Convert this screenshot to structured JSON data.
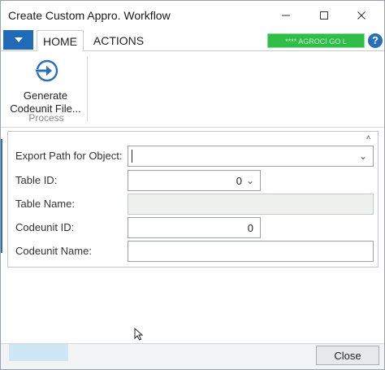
{
  "window": {
    "title": "Create Custom Appro. Workflow",
    "controls": {
      "minimize": "—",
      "maximize": "☐",
      "close": "✕"
    }
  },
  "tabs": [
    {
      "label": "HOME",
      "active": true
    },
    {
      "label": "ACTIONS",
      "active": false
    }
  ],
  "user_badge": "**** AGROCI GO L",
  "help_label": "?",
  "ribbon": {
    "buttons": [
      {
        "label_line1": "Generate",
        "label_line2": "Codeunit File...",
        "icon": "arrow-right-circle-icon"
      }
    ],
    "group_label": "Process"
  },
  "form": {
    "collapse_glyph": "˄",
    "fields": [
      {
        "label": "Export Path for Object:",
        "value": "",
        "type": "dropdown"
      },
      {
        "label": "Table ID:",
        "value": "0",
        "type": "dropdown"
      },
      {
        "label": "Table Name:",
        "value": "",
        "type": "readonly"
      },
      {
        "label": "Codeunit ID:",
        "value": "0",
        "type": "number"
      },
      {
        "label": "Codeunit Name:",
        "value": "",
        "type": "text"
      }
    ]
  },
  "footer": {
    "close_label": "Close"
  },
  "colors": {
    "accent": "#1f6bb7",
    "user_badge": "#2fbf48",
    "readonly_field": "#eef1ee"
  }
}
